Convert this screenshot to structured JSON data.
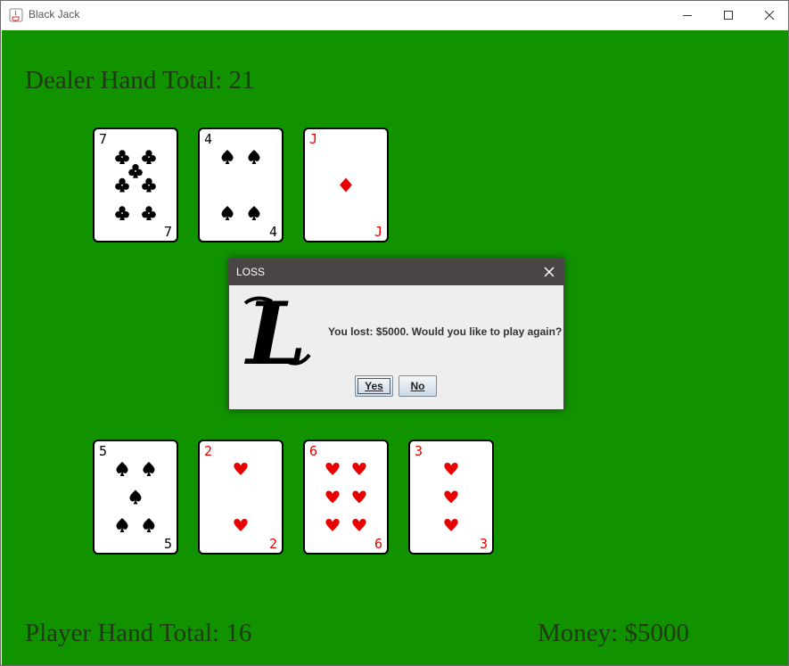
{
  "window": {
    "title": "Black Jack",
    "icon": "java-icon"
  },
  "game": {
    "dealer_label": "Dealer Hand Total: 21",
    "player_label": "Player Hand Total: 16",
    "money_label": "Money: $5000"
  },
  "dealer_cards": [
    {
      "rank": "7",
      "suit": "clubs",
      "color": "#000000"
    },
    {
      "rank": "4",
      "suit": "spades",
      "color": "#000000"
    },
    {
      "rank": "J",
      "suit": "diamonds",
      "color": "#e80000"
    }
  ],
  "player_cards": [
    {
      "rank": "5",
      "suit": "spades",
      "color": "#000000"
    },
    {
      "rank": "2",
      "suit": "hearts",
      "color": "#e80000"
    },
    {
      "rank": "6",
      "suit": "hearts",
      "color": "#e80000"
    },
    {
      "rank": "3",
      "suit": "hearts",
      "color": "#e80000"
    }
  ],
  "dialog": {
    "title": "LOSS",
    "icon": "gothic-letter-l-icon",
    "icon_letter": "L",
    "message": "You lost: $5000. Would you like to play again?",
    "yes_label": "Yes",
    "no_label": "No"
  },
  "colors": {
    "table": "#119300",
    "text": "#1f3a14",
    "red": "#e80000"
  }
}
